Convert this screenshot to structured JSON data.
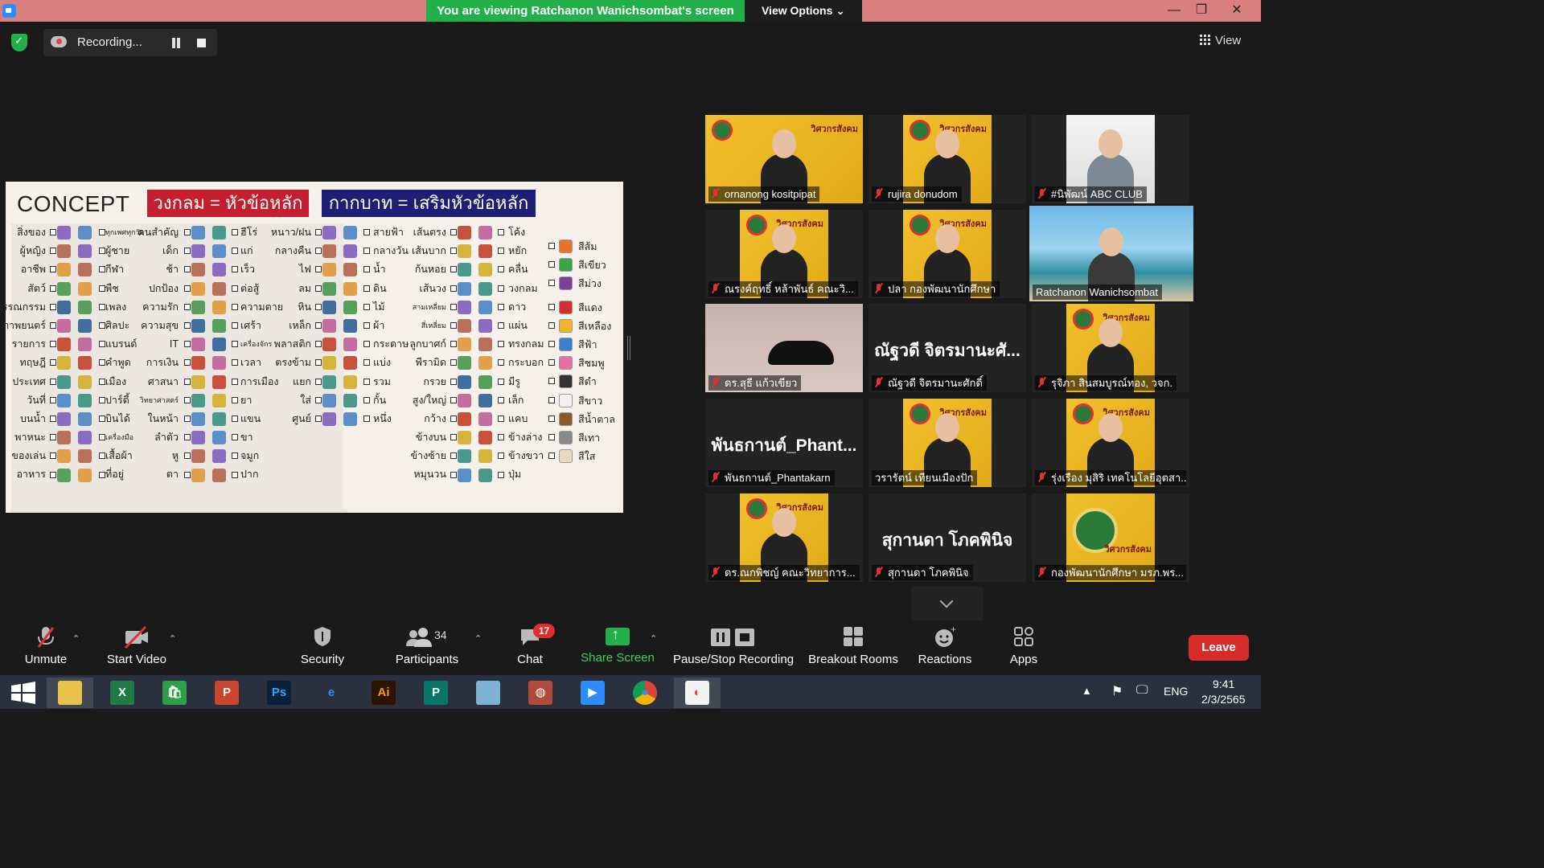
{
  "window": {
    "banner": "You are viewing Ratchanon Wanichsombat's screen",
    "view_options": "View Options ⌄",
    "minimize": "—",
    "restore": "❐",
    "close": "✕"
  },
  "recording": {
    "label": "Recording...",
    "view_label": "View"
  },
  "slide": {
    "title": "CONCEPT",
    "red_label": "วงกลม = หัวข้อหลัก",
    "blue_label": "กากบาท = เสริมหัวข้อหลัก",
    "col1": [
      "สิ่งของ",
      "ผู้หญิง",
      "อาชีพ",
      "สัตว์",
      "วรรณกรรม",
      "ภาพยนตร์",
      "รายการ",
      "ทฤษฎี",
      "ประเทศ",
      "วันที่",
      "บนน้ำ",
      "พาหนะ",
      "ของเล่น",
      "อาหาร"
    ],
    "col2": [
      "ทุกเพศทุกวัย",
      "ผู้ชาย",
      "กีฬา",
      "พืช",
      "เพลง",
      "ศิลปะ",
      "แบรนด์",
      "คำพูด",
      "เมือง",
      "ปาร์ตี้",
      "บินได้",
      "เครื่องมือ",
      "เสื้อผ้า",
      "ที่อยู่"
    ],
    "col3": [
      "คนสำคัญ",
      "เด็ก",
      "ช้า",
      "ปกป้อง",
      "ความรัก",
      "ความสุข",
      "IT",
      "การเงิน",
      "ศาสนา",
      "วิทยาศาสตร์",
      "ในหน้า",
      "ลำตัว",
      "หู",
      "ตา"
    ],
    "col4": [
      "ฮีโร่",
      "แก่",
      "เร็ว",
      "ต่อสู้",
      "ความตาย",
      "เศร้า",
      "เครื่องจักร",
      "เวลา",
      "การเมือง",
      "ยา",
      "แขน",
      "ขา",
      "จมูก",
      "ปาก"
    ],
    "col5": [
      "หนาว/ฝน",
      "กลางคืน",
      "ไฟ",
      "ลม",
      "หิน",
      "เหล็ก",
      "พลาสติก",
      "ตรงข้าม",
      "แยก",
      "ใส่",
      "ศูนย์"
    ],
    "col6": [
      "สายฟ้า",
      "กลางวัน",
      "น้ำ",
      "ดิน",
      "ไม้",
      "ผ้า",
      "กระดาษ",
      "แบ่ง",
      "รวม",
      "กั้น",
      "หนึ่ง"
    ],
    "col7": [
      "เส้นตรง",
      "เส้นบาก",
      "ก้นหอย",
      "เส้นวง",
      "สามเหลี่ยม",
      "สี่เหลี่ยม",
      "ลูกบาศก์",
      "พีรามิด",
      "กรวย",
      "สูง/ใหญ่",
      "กว้าง",
      "ข้างบน",
      "ข้างซ้าย",
      "หมุนวน"
    ],
    "col8": [
      "โค้ง",
      "หยัก",
      "คลื่น",
      "วงกลม",
      "ดาว",
      "แผ่น",
      "ทรงกลม",
      "กระบอก",
      "มีรู",
      "เล็ก",
      "แคบ",
      "ข้างล่าง",
      "ข้างขวา",
      "ปุ่ม"
    ],
    "colors": [
      "สีส้ม",
      "สีเขียว",
      "สีม่วง",
      "สีแดง",
      "สีเหลือง",
      "สีฟ้า",
      "สีชมพู",
      "สีดำ",
      "สีขาว",
      "สีน้ำตาล",
      "สีเทา",
      "สีใส"
    ],
    "swatches": [
      "#e8742a",
      "#3aa64a",
      "#7b3f9e",
      "#d62d2d",
      "#f1b52c",
      "#3a7fd0",
      "#e86fa2",
      "#333333",
      "#f2f2f2",
      "#8b5a2b",
      "#8a8a8a",
      "#e8d8c0"
    ]
  },
  "gallery": [
    {
      "name": "ornanong kositpipat",
      "muted": true,
      "kind": "banner"
    },
    {
      "name": "rujira donudom",
      "muted": true,
      "kind": "banner"
    },
    {
      "name": "#นิพัฒน์ ABC CLUB",
      "muted": true,
      "kind": "photo"
    },
    {
      "name": "ณรงค์ฤทธิ์ หล้าพันธ์ คณะวิ...",
      "muted": true,
      "kind": "banner"
    },
    {
      "name": "ปลา กองพัฒนานักศึกษา",
      "muted": true,
      "kind": "banner"
    },
    {
      "name": "Ratchanon Wanichsombat",
      "muted": false,
      "kind": "beach"
    },
    {
      "name": "ดร.สุธี แก้วเขียว",
      "muted": true,
      "kind": "chair"
    },
    {
      "name": "ณัฐวดี จิตรมานะศักดิ์",
      "muted": true,
      "kind": "text",
      "big": "ณัฐวดี จิตรมานะศั..."
    },
    {
      "name": "รุจิภา สินสมบูรณ์ทอง, วจก.",
      "muted": true,
      "kind": "banner"
    },
    {
      "name": "พันธกานต์_Phantakarn",
      "muted": true,
      "kind": "text",
      "big": "พันธกานต์_Phant..."
    },
    {
      "name": "วรารัตน์ เทียนเมืองปัก",
      "muted": false,
      "kind": "banner"
    },
    {
      "name": "รุ่งเรือง มุสิริ เทคโนโลยีอุตสา...",
      "muted": true,
      "kind": "banner"
    },
    {
      "name": "ดร.ณกพิชญ์ คณะวิทยาการ...",
      "muted": true,
      "kind": "banner"
    },
    {
      "name": "สุกานดา โภคพินิจ",
      "muted": true,
      "kind": "text",
      "big": "สุกานดา โภคพินิจ"
    },
    {
      "name": "กองพัฒนานักศึกษา มรภ.พร...",
      "muted": true,
      "kind": "logo"
    }
  ],
  "banner_slogan": "วิศวกรสังคม",
  "toolbar": {
    "unmute": "Unmute",
    "start_video": "Start Video",
    "security": "Security",
    "participants": "Participants",
    "participants_count": "34",
    "chat": "Chat",
    "chat_badge": "17",
    "share_screen": "Share Screen",
    "pause_stop": "Pause/Stop Recording",
    "breakout": "Breakout Rooms",
    "reactions": "Reactions",
    "apps": "Apps",
    "leave": "Leave"
  },
  "taskbar": {
    "apps": [
      "explorer",
      "excel",
      "store",
      "powerpoint",
      "photoshop",
      "edge",
      "illustrator",
      "publisher",
      "notepad",
      "photoscape",
      "zoom",
      "chrome",
      "paint"
    ],
    "ps_label": "Ps",
    "ai_label": "Ai",
    "lang": "ENG",
    "time": "9:41",
    "date": "2/3/2565"
  }
}
